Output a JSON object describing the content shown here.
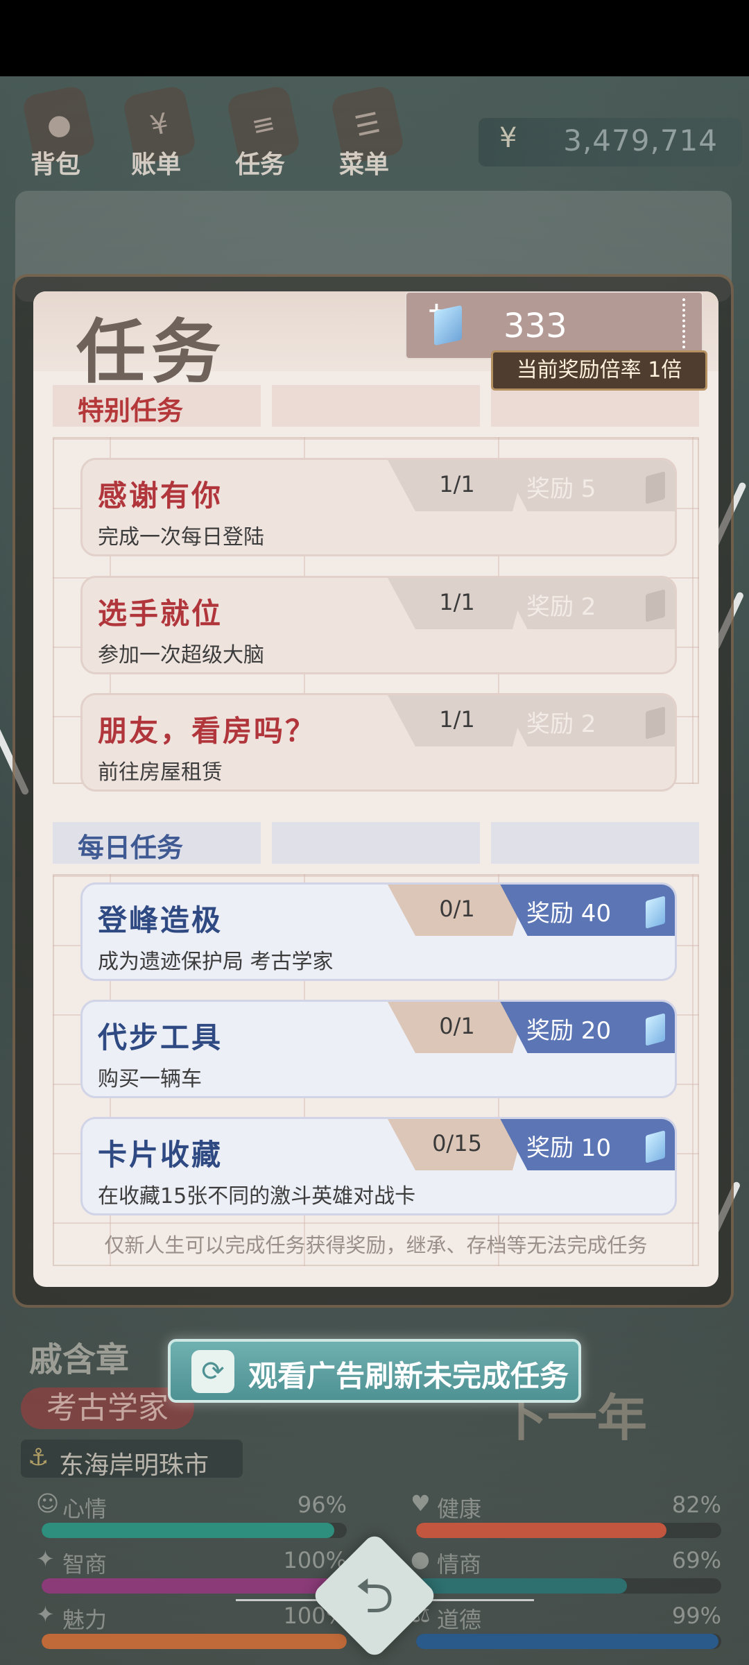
{
  "nav": {
    "items": [
      {
        "label": "背包",
        "icon": "backpack-icon"
      },
      {
        "label": "账单",
        "icon": "wallet-icon"
      },
      {
        "label": "任务",
        "icon": "tasks-icon"
      },
      {
        "label": "菜单",
        "icon": "menu-icon"
      }
    ],
    "currency_symbol": "¥",
    "money": "3,479,714"
  },
  "modal": {
    "title": "任务",
    "gem_count": "333",
    "multiplier": "当前奖励倍率 1倍",
    "special": {
      "tab_label": "特别任务",
      "tasks": [
        {
          "title": "感谢有你",
          "desc": "完成一次每日登陆",
          "progress": "1/1",
          "reward": "奖励 5"
        },
        {
          "title": "选手就位",
          "desc": "参加一次超级大脑",
          "progress": "1/1",
          "reward": "奖励 2"
        },
        {
          "title": "朋友，看房吗？",
          "desc": "前往房屋租赁",
          "progress": "1/1",
          "reward": "奖励 2"
        }
      ]
    },
    "daily": {
      "tab_label": "每日任务",
      "tasks": [
        {
          "title": "登峰造极",
          "desc": "成为遗迹保护局 考古学家",
          "progress": "0/1",
          "reward": "奖励 40"
        },
        {
          "title": "代步工具",
          "desc": "购买一辆车",
          "progress": "0/1",
          "reward": "奖励 20"
        },
        {
          "title": "卡片收藏",
          "desc": "在收藏15张不同的激斗英雄对战卡",
          "progress": "0/15",
          "reward": "奖励 10"
        }
      ]
    },
    "notice": "仅新人生可以完成任务获得奖励，继承、存档等无法完成任务"
  },
  "ad_button": {
    "label": "观看广告刷新未完成任务"
  },
  "character": {
    "name": "戚含章",
    "job": "考古学家",
    "city": "东海岸明珠市",
    "next_year": "下一年"
  },
  "stats": [
    {
      "label": "心情",
      "value": "96%",
      "fraction": 0.96,
      "color": "#2f8f7e",
      "icon": "smile-icon"
    },
    {
      "label": "健康",
      "value": "82%",
      "fraction": 0.82,
      "color": "#c2563e",
      "icon": "heart-icon"
    },
    {
      "label": "智商",
      "value": "100%",
      "fraction": 1.0,
      "color": "#8a3b78",
      "icon": "bulb-icon"
    },
    {
      "label": "情商",
      "value": "69%",
      "fraction": 0.69,
      "color": "#2e6f6f",
      "icon": "apple-icon"
    },
    {
      "label": "魅力",
      "value": "100%",
      "fraction": 1.0,
      "color": "#c06a3a",
      "icon": "star-icon"
    },
    {
      "label": "道德",
      "value": "99%",
      "fraction": 0.99,
      "color": "#2a5a8a",
      "icon": "scale-icon"
    }
  ]
}
